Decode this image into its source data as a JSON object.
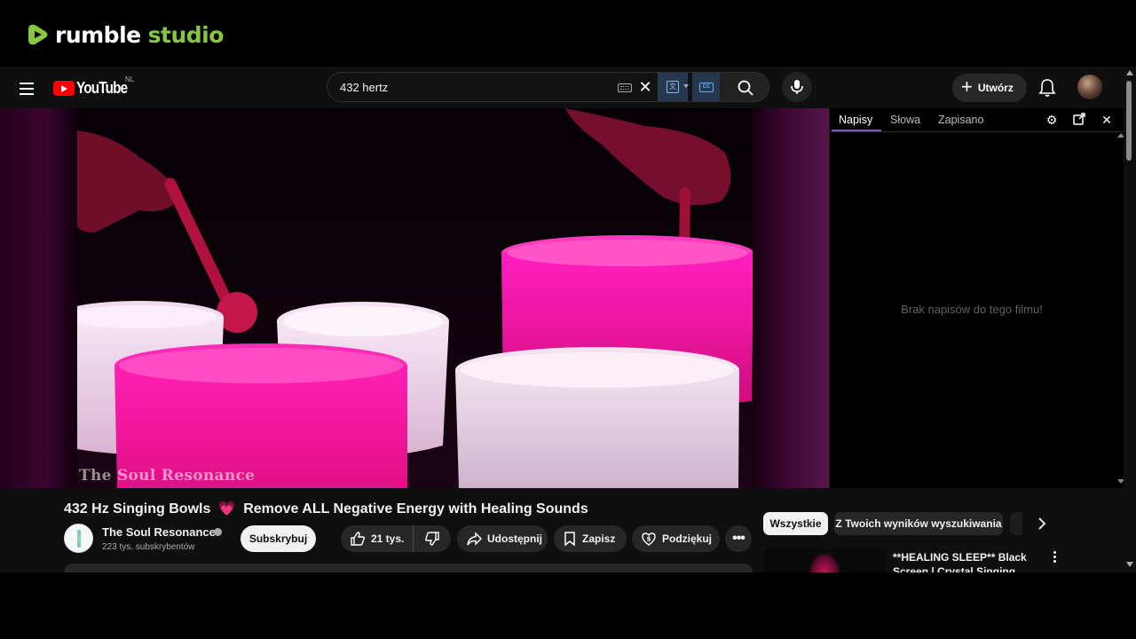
{
  "rumble": {
    "word1": "rumble",
    "word2": "studio"
  },
  "masthead": {
    "logo_text": "YouTube",
    "country": "NL",
    "search_query": "432 hertz",
    "create_label": "Utwórz"
  },
  "video": {
    "watermark": "The Soul Resonance",
    "title_part1": "432 Hz Singing Bowls",
    "title_emoji": "💗",
    "title_part2": "Remove ALL Negative Energy with Healing Sounds"
  },
  "transcript": {
    "tabs": [
      "Napisy",
      "Słowa",
      "Zapisano"
    ],
    "active_tab": "Napisy",
    "empty_message": "Brak napisów do tego filmu!"
  },
  "channel": {
    "name": "The Soul Resonance",
    "subscribers": "223 tys. subskrybentów",
    "subscribe_label": "Subskrybuj"
  },
  "actions": {
    "likes": "21 tys.",
    "share": "Udostępnij",
    "save": "Zapisz",
    "thanks": "Podziękuj"
  },
  "chips": [
    "Wszystkie",
    "Z Twoich wyników wyszukiwania"
  ],
  "recommendation": {
    "title": "**HEALING SLEEP** Black Screen | Crystal Singing Bowls"
  },
  "colors": {
    "rumble_green": "#85c742",
    "youtube_red": "#ff0000",
    "background": "#0f0f0f",
    "accent_magenta": "#e0107f"
  }
}
